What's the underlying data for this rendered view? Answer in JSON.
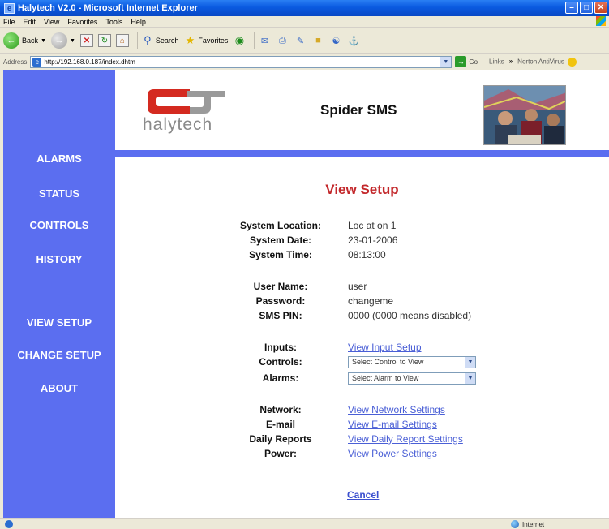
{
  "window": {
    "title": "Halytech V2.0 - Microsoft Internet Explorer"
  },
  "menu": [
    "File",
    "Edit",
    "View",
    "Favorites",
    "Tools",
    "Help"
  ],
  "toolbar": {
    "back_label": "Back",
    "search_label": "Search",
    "favorites_label": "Favorites"
  },
  "address": {
    "label": "Address",
    "url": "http://192.168.0.187/index.dhtm",
    "go_label": "Go",
    "links_label": "Links",
    "chevron": "»",
    "norton_label": "Norton AntiVirus"
  },
  "header": {
    "logo_text": "halytech",
    "app_title": "Spider SMS"
  },
  "nav": [
    {
      "label": "ALARMS"
    },
    {
      "label": "STATUS"
    },
    {
      "label": "CONTROLS"
    },
    {
      "label": "HISTORY"
    },
    {
      "label": "VIEW SETUP"
    },
    {
      "label": "CHANGE SETUP"
    },
    {
      "label": "ABOUT"
    }
  ],
  "main": {
    "title": "View Setup",
    "system": {
      "location_label": "System Location:",
      "location_value": "Loc at on 1",
      "date_label": "System Date:",
      "date_value": "23-01-2006",
      "time_label": "System Time:",
      "time_value": "08:13:00"
    },
    "user": {
      "name_label": "User Name:",
      "name_value": "user",
      "password_label": "Password:",
      "password_value": "changeme",
      "pin_label": "SMS PIN:",
      "pin_value": "0000 (0000 means disabled)"
    },
    "io": {
      "inputs_label": "Inputs:",
      "inputs_link": "View Input Setup",
      "controls_label": "Controls:",
      "controls_select": "Select Control to View",
      "alarms_label": "Alarms:",
      "alarms_select": "Select Alarm to View"
    },
    "settings": {
      "network_label": "Network:",
      "network_link": "View Network Settings",
      "email_label": "E-mail",
      "email_link": "View E-mail Settings",
      "reports_label": "Daily Reports",
      "reports_link": "View Daily Report Settings",
      "power_label": "Power:",
      "power_link": "View Power Settings"
    },
    "cancel_label": "Cancel"
  },
  "status": {
    "zone": "Internet"
  }
}
